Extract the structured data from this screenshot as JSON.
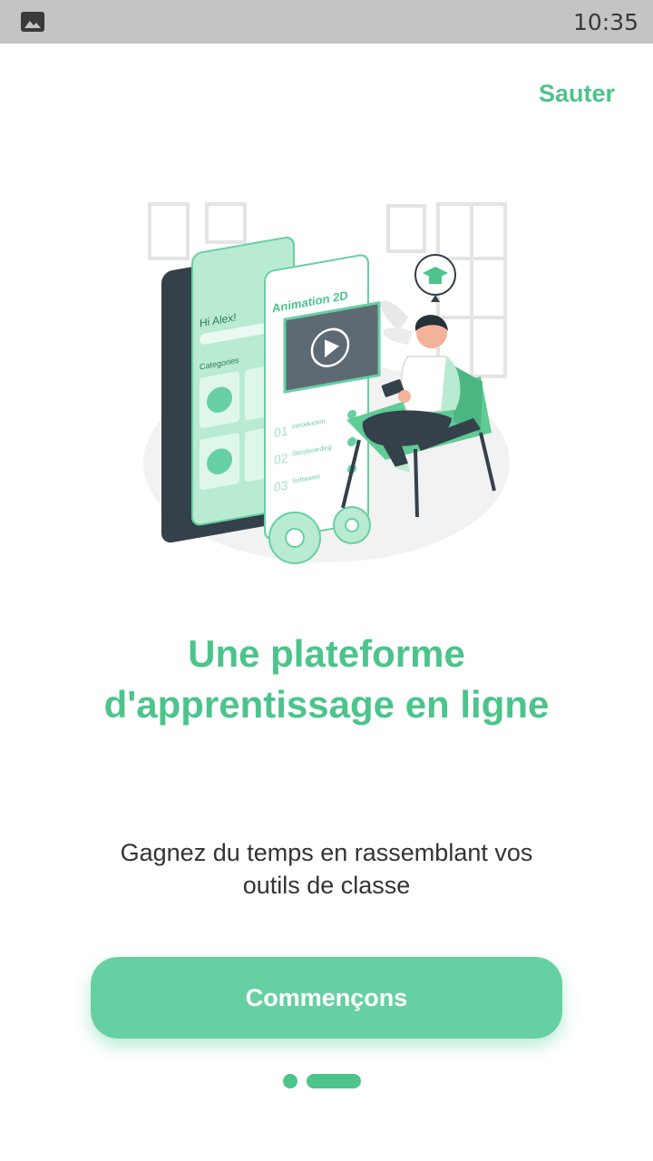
{
  "status_bar": {
    "time": "10:35",
    "icons": [
      "gallery-icon"
    ]
  },
  "header": {
    "skip_label": "Sauter"
  },
  "illustration": {
    "phone_greeting": "Hi Alex!",
    "phone_section": "Categories",
    "course_title": "Animation 2D",
    "lessons": [
      {
        "number": "01",
        "name": "Introduction"
      },
      {
        "number": "02",
        "name": "Storyboarding"
      },
      {
        "number": "03",
        "name": "Softwares"
      }
    ],
    "accent_color": "#67d0a2"
  },
  "main": {
    "title": "Une plateforme d'apprentissage en ligne",
    "subtitle": "Gagnez du temps en rassemblant vos outils de classe",
    "cta_label": "Commençons"
  },
  "pager": {
    "total_pages": 2,
    "current_page": 2
  },
  "colors": {
    "primary": "#4cc48b",
    "button": "#67d0a2",
    "status_bar": "#c4c4c4"
  }
}
